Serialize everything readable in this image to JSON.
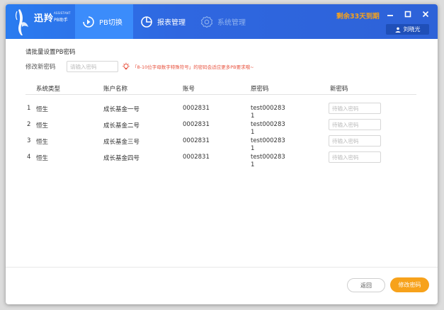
{
  "app": {
    "logo_cn": "迅羚",
    "logo_en": "ASSISTANT",
    "logo_sub": "PB助手"
  },
  "nav": {
    "pb_label": "PB切换",
    "report_label": "报表管理",
    "system_label": "系统管理"
  },
  "header": {
    "expire_text": "剩余33天到期",
    "user_name": "刘晓光"
  },
  "section": {
    "title": "请批量设置PB密码",
    "modify_label": "修改新密码",
    "modify_placeholder": "请输入密码",
    "hint": "「8-10位字母数字特殊符号」的密码会适应更多PB要求哦~"
  },
  "table": {
    "headers": [
      "系统类型",
      "账户名称",
      "账号",
      "原密码",
      "新密码"
    ],
    "new_placeholder": "待输入密码",
    "rows": [
      {
        "idx": "1",
        "type": "恒生",
        "name": "成长基金一号",
        "account": "0002831",
        "orig": "test0002831"
      },
      {
        "idx": "2",
        "type": "恒生",
        "name": "成长基金二号",
        "account": "0002831",
        "orig": "test0002831"
      },
      {
        "idx": "3",
        "type": "恒生",
        "name": "成长基金三号",
        "account": "0002831",
        "orig": "test0002831"
      },
      {
        "idx": "4",
        "type": "恒生",
        "name": "成长基金四号",
        "account": "0002831",
        "orig": "test0002831"
      }
    ]
  },
  "footer": {
    "back_label": "返回",
    "submit_label": "修改密码"
  },
  "colors": {
    "header_blue": "#2d62d8",
    "active_tab": "#3b8cfb",
    "accent_orange": "#f7a21b",
    "hint_red": "#e8533f"
  },
  "icons": {
    "pb": "pb-switch-icon",
    "report": "pie-chart-icon",
    "system": "gear-icon",
    "user": "user-icon",
    "hint": "lightbulb-icon"
  }
}
